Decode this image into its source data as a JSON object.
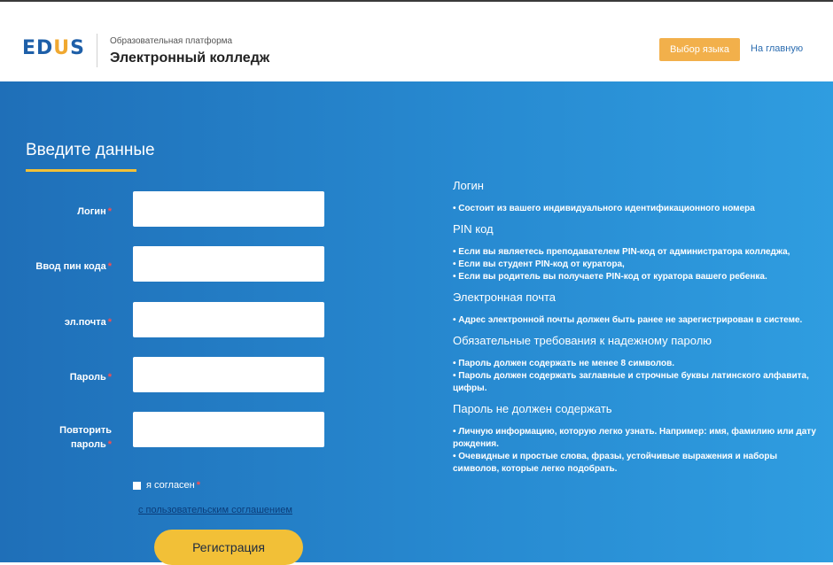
{
  "header": {
    "logo_text": "EDUS",
    "platform_subtitle": "Образовательная платформа",
    "platform_title": "Электронный колледж",
    "language_button": "Выбор языка",
    "home_link": "На главную"
  },
  "form": {
    "title": "Введите данные",
    "fields": [
      {
        "label": "Логин",
        "value": ""
      },
      {
        "label": "Ввод пин кода",
        "value": ""
      },
      {
        "label": "эл.почта",
        "value": ""
      },
      {
        "label": "Пароль",
        "value": ""
      },
      {
        "label_line1": "Повторить",
        "label_line2": "пароль",
        "value": ""
      }
    ],
    "required_mark": "*",
    "agree_label": "я согласен",
    "agreement_link": "с пользовательским соглашением",
    "register_button": "Регистрация"
  },
  "info": {
    "sections": [
      {
        "heading": "Логин",
        "lines": [
          "• Состоит из вашего индивидуального идентификационного номера"
        ]
      },
      {
        "heading": "PIN код",
        "lines": [
          "• Если вы являетесь преподавателем PIN-код от администратора колледжа,",
          "• Если вы студент PIN-код от куратора,",
          "• Если вы родитель вы получаете PIN-код от куратора вашего ребенка."
        ]
      },
      {
        "heading": "Электронная почта",
        "lines": [
          "• Адрес электронной почты должен быть ранее не зарегистрирован в системе."
        ]
      },
      {
        "heading": "Обязательные требования к надежному паролю",
        "lines": [
          "• Пароль должен содержать не менее 8 символов.",
          "• Пароль должен содержать заглавные и строчные буквы латинского алфавита, цифры."
        ]
      },
      {
        "heading": "Пароль не должен содержать",
        "lines": [
          "• Личную информацию, которую легко узнать. Например: имя, фамилию или дату рождения.",
          "• Очевидные и простые слова, фразы, устойчивые выражения и наборы символов, которые легко подобрать."
        ]
      }
    ]
  },
  "colors": {
    "accent_yellow": "#f2c037",
    "language_button": "#f2b04b",
    "hero_blue": "#2789d0",
    "required": "#ff4d4d"
  }
}
